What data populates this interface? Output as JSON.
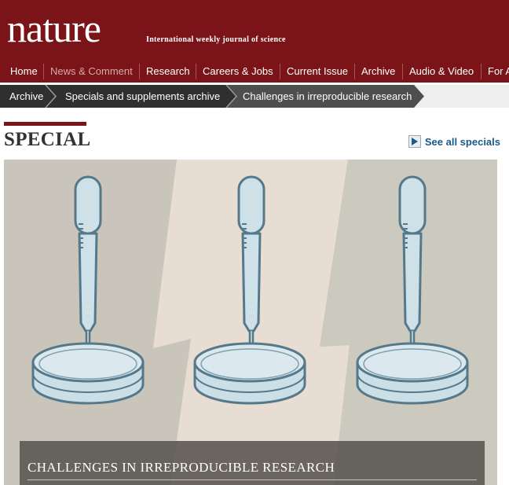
{
  "masthead": {
    "logo": "nature",
    "tagline": "International weekly journal of science",
    "background": "#7a1419"
  },
  "nav": {
    "items": [
      {
        "label": "Home"
      },
      {
        "label": "News & Comment",
        "active": true
      },
      {
        "label": "Research"
      },
      {
        "label": "Careers & Jobs"
      },
      {
        "label": "Current Issue"
      },
      {
        "label": "Archive"
      },
      {
        "label": "Audio & Video"
      },
      {
        "label": "For A"
      }
    ]
  },
  "breadcrumb": {
    "items": [
      {
        "label": "Archive"
      },
      {
        "label": "Specials and supplements archive"
      },
      {
        "label": "Challenges in irreproducible research"
      }
    ]
  },
  "special": {
    "title": "SPECIAL",
    "see_all_label": "See all specials",
    "see_all_icon": "play-arrow-icon"
  },
  "hero": {
    "caption": "CHALLENGES IN IRREPRODUCIBLE RESEARCH",
    "illustration_icons": [
      "pipette-icon",
      "petri-dish-icon"
    ]
  }
}
